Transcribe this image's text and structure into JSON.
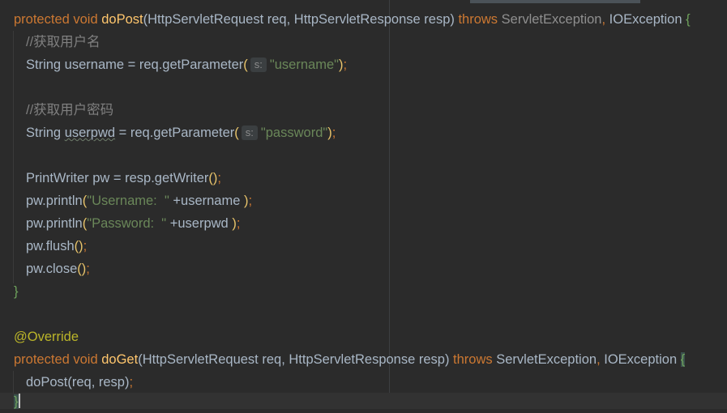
{
  "code": {
    "l1": {
      "kw": "protected void ",
      "fn": "doPost",
      "open": "(",
      "params": "HttpServletRequest req, HttpServletResponse resp",
      "close": ")",
      "throws": " throws ",
      "ex1": "ServletException",
      "comma": ", ",
      "ex2": "IOException",
      "brace": " {"
    },
    "l2": {
      "comment": "//获取用户名"
    },
    "l3": {
      "pre": "String username = req.getParameter",
      "open": "(",
      "hint": "s:",
      "str": "\"username\"",
      "close": ")",
      "semi": ";"
    },
    "l5": {
      "comment": "//获取用户密码"
    },
    "l6": {
      "pre": "String ",
      "var": "userpwd",
      "mid": " = req.getParameter",
      "open": "(",
      "hint": "s:",
      "str": "\"password\"",
      "close": ")",
      "semi": ";"
    },
    "l8": {
      "pre": "PrintWriter pw = resp.getWriter",
      "parens": "()",
      "semi": ";"
    },
    "l9": {
      "pre": "pw.println",
      "open": "(",
      "str": "\"Username:  \"",
      "rest": " +username ",
      "close": ")",
      "semi": ";"
    },
    "l10": {
      "pre": "pw.println",
      "open": "(",
      "str": "\"Password:  \"",
      "rest": " +userpwd ",
      "close": ")",
      "semi": ";"
    },
    "l11": {
      "pre": "pw.flush",
      "parens": "()",
      "semi": ";"
    },
    "l12": {
      "pre": "pw.close",
      "parens": "()",
      "semi": ";"
    },
    "l13": {
      "brace": "}"
    },
    "l15": {
      "ann": "@Override"
    },
    "l16": {
      "kw": "protected void ",
      "fn": "doGet",
      "open": "(",
      "params": "HttpServletRequest req, HttpServletResponse resp",
      "close": ")",
      "throws": " throws ",
      "ex1": "ServletException",
      "comma": ", ",
      "ex2": "IOException",
      "sp": " ",
      "brace": "{"
    },
    "l17": {
      "pre": "doPost(req, resp)",
      "semi": ";"
    },
    "l18": {
      "brace": "}"
    }
  },
  "colors": {
    "background": "#2b2b2b",
    "keyword": "#cc7832",
    "function": "#ffc66d",
    "string": "#6a8759",
    "comment": "#808080",
    "annotation": "#bbb529",
    "text": "#a9b7c6"
  }
}
